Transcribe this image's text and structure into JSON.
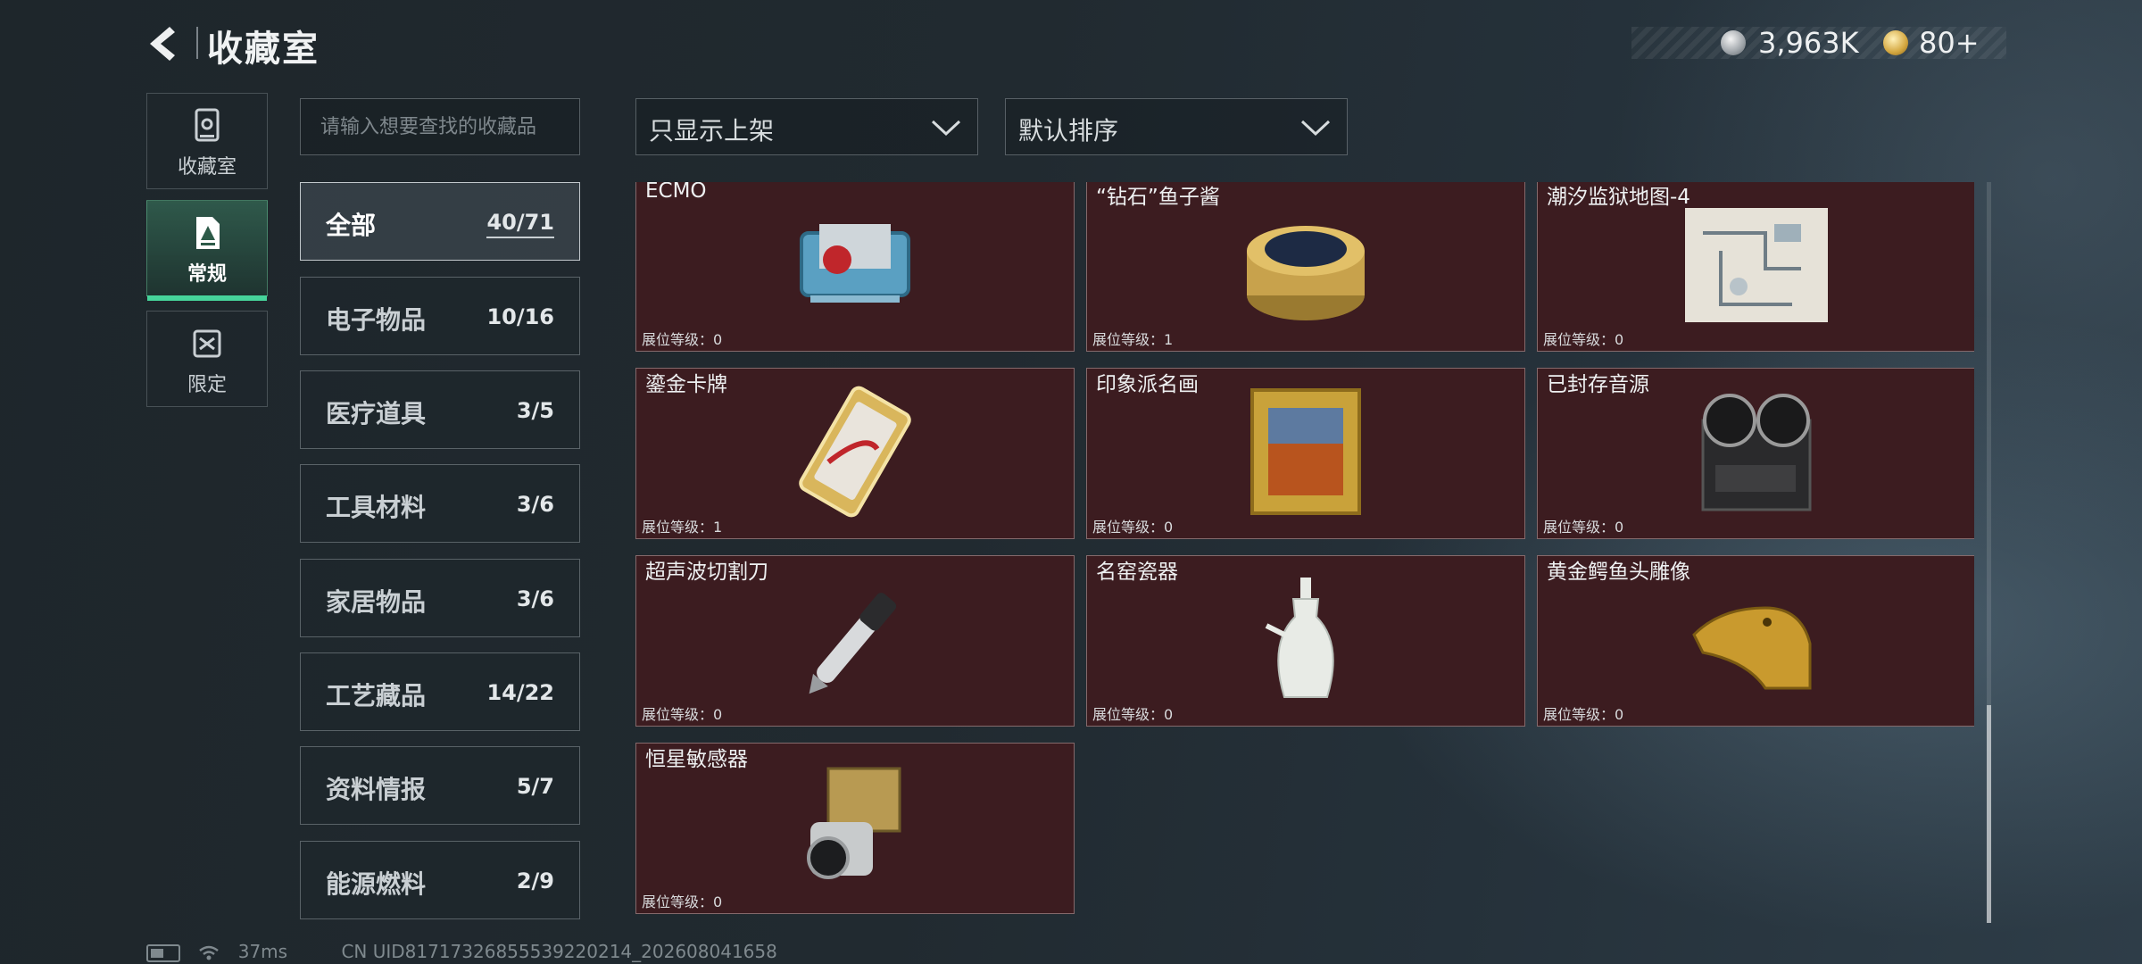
{
  "header": {
    "title": "收藏室",
    "currency_silver": "3,963K",
    "currency_gold": "80+"
  },
  "left_tabs": [
    {
      "label": "收藏室",
      "icon": "collection-room-icon",
      "active": false
    },
    {
      "label": "常规",
      "icon": "regular-icon",
      "active": true
    },
    {
      "label": "限定",
      "icon": "limited-icon",
      "active": false
    }
  ],
  "search": {
    "placeholder": "请输入想要查找的收藏品"
  },
  "filters": {
    "display_filter": "只显示上架",
    "sort": "默认排序"
  },
  "categories": [
    {
      "name": "全部",
      "count": "40/71",
      "active": true
    },
    {
      "name": "电子物品",
      "count": "10/16"
    },
    {
      "name": "医疗道具",
      "count": "3/5"
    },
    {
      "name": "工具材料",
      "count": "3/6"
    },
    {
      "name": "家居物品",
      "count": "3/6"
    },
    {
      "name": "工艺藏品",
      "count": "14/22"
    },
    {
      "name": "资料情报",
      "count": "5/7"
    },
    {
      "name": "能源燃料",
      "count": "2/9"
    }
  ],
  "items": [
    {
      "name": "ECMO",
      "level": "展位等级：0",
      "icon": "ecmo-machine-icon"
    },
    {
      "name": "“钻石”鱼子酱",
      "level": "展位等级：1",
      "icon": "caviar-tin-icon"
    },
    {
      "name": "潮汐监狱地图-4",
      "level": "展位等级：0",
      "icon": "prison-map-icon"
    },
    {
      "name": "鎏金卡牌",
      "level": "展位等级：1",
      "icon": "gilded-card-icon"
    },
    {
      "name": "印象派名画",
      "level": "展位等级：0",
      "icon": "framed-painting-icon"
    },
    {
      "name": "已封存音源",
      "level": "展位等级：0",
      "icon": "reel-to-reel-recorder-icon"
    },
    {
      "name": "超声波切割刀",
      "level": "展位等级：0",
      "icon": "ultrasonic-cutter-icon"
    },
    {
      "name": "名窑瓷器",
      "level": "展位等级：0",
      "icon": "porcelain-vase-icon"
    },
    {
      "name": "黄金鳄鱼头雕像",
      "level": "展位等级：0",
      "icon": "golden-crocodile-head-icon"
    },
    {
      "name": "恒星敏感器",
      "level": "展位等级：0",
      "icon": "star-sensor-icon"
    }
  ],
  "status_bar": {
    "ping": "37ms",
    "uid": "CN UID81717326855539220214_202608041658"
  },
  "colors": {
    "card_bg": "#3c1c20",
    "active_tab_accent": "#46d49a"
  }
}
